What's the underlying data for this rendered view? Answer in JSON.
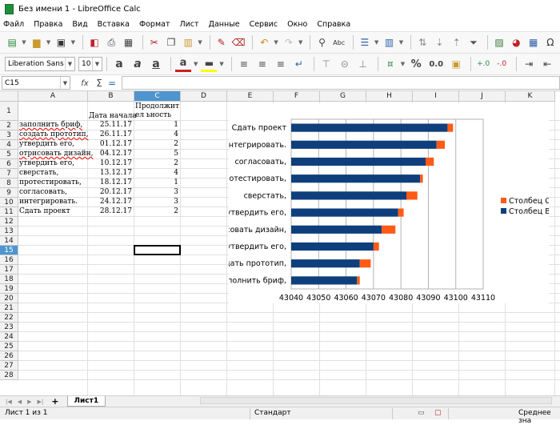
{
  "window": {
    "title": "Без имени 1 - LibreOffice Calc"
  },
  "menu": [
    "Файл",
    "Правка",
    "Вид",
    "Вставка",
    "Формат",
    "Лист",
    "Данные",
    "Сервис",
    "Окно",
    "Справка"
  ],
  "toolbar2": {
    "font_name": "Liberation Sans",
    "font_size": "10",
    "percent": "%",
    "decimal": "0.0"
  },
  "formula_bar": {
    "cell_ref": "C15",
    "value": ""
  },
  "columns": [
    "A",
    "B",
    "C",
    "D",
    "E",
    "F",
    "G",
    "H",
    "I",
    "J",
    "K"
  ],
  "selected_column": "C",
  "selected_row": "15",
  "rows": [
    "1",
    "2",
    "3",
    "4",
    "5",
    "6",
    "7",
    "8",
    "9",
    "10",
    "11",
    "12",
    "13",
    "14",
    "15",
    "16",
    "17",
    "18",
    "19",
    "20",
    "21",
    "22",
    "23",
    "24",
    "25",
    "26",
    "27",
    "28"
  ],
  "headers": {
    "b1": "Дата начала",
    "c1": "Продолжител ьность"
  },
  "tasks": [
    {
      "name": "заполнить бриф,",
      "start": "25.11.17",
      "dur": "1"
    },
    {
      "name": "создать прототип,",
      "start": "26.11.17",
      "dur": "4"
    },
    {
      "name": "утвердить его,",
      "start": "01.12.17",
      "dur": "2"
    },
    {
      "name": "отрисовать дизайн,",
      "start": "04.12.17",
      "dur": "5"
    },
    {
      "name": "утвердить его,",
      "start": "10.12.17",
      "dur": "2"
    },
    {
      "name": "сверстать,",
      "start": "13.12.17",
      "dur": "4"
    },
    {
      "name": "протестировать,",
      "start": "18.12.17",
      "dur": "1"
    },
    {
      "name": "согласовать,",
      "start": "20.12.17",
      "dur": "3"
    },
    {
      "name": "интегрировать.",
      "start": "24.12.17",
      "dur": "3"
    },
    {
      "name": "Сдать проект",
      "start": "28.12.17",
      "dur": "2"
    }
  ],
  "chart_data": {
    "type": "bar",
    "orientation": "horizontal",
    "stacked": true,
    "categories": [
      "заполнить бриф,",
      "создать прототип,",
      "утвердить его,",
      "отрисовать дизайн,",
      "утвердить его,",
      "сверстать,",
      "протестировать,",
      "согласовать,",
      "интегрировать.",
      "Сдать проект"
    ],
    "series": [
      {
        "name": "Столбец B",
        "color": "#0e3f7c",
        "values": [
          43064,
          43065,
          43070,
          43073,
          43079,
          43082,
          43087,
          43089,
          43093,
          43097
        ]
      },
      {
        "name": "Столбец C",
        "color": "#ff5b16",
        "values": [
          1,
          4,
          2,
          5,
          2,
          4,
          1,
          3,
          3,
          2
        ]
      }
    ],
    "xlim": [
      43040,
      43110
    ],
    "xticks": [
      "43040",
      "43050",
      "43060",
      "43070",
      "43080",
      "43090",
      "43100",
      "43110"
    ],
    "legend": [
      "Столбец C",
      "Столбец B"
    ],
    "legend_position": "right",
    "grid": true
  },
  "sheet_tab": {
    "label": "Лист1",
    "add": "+"
  },
  "status": {
    "sheet": "Лист 1 из 1",
    "style": "Стандарт",
    "summary": "Среднее зна"
  }
}
